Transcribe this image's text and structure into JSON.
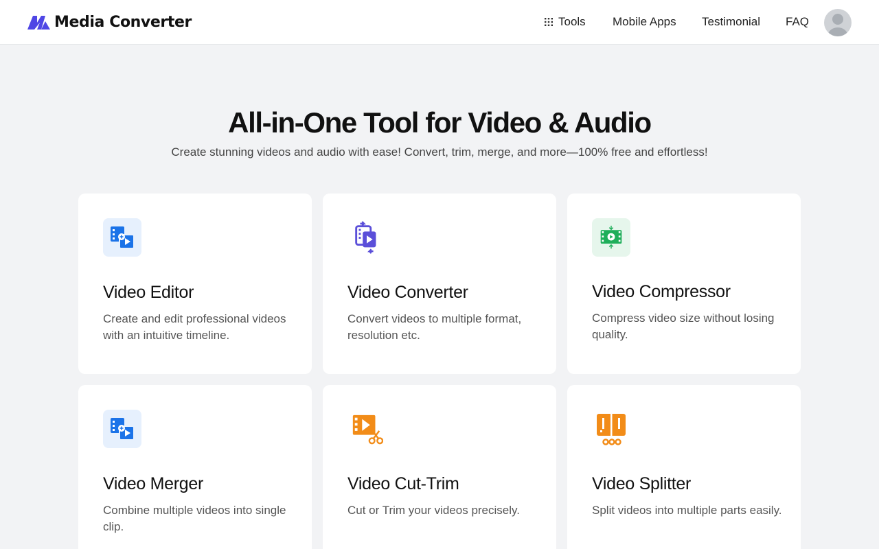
{
  "header": {
    "brand": "Media Converter",
    "nav": [
      {
        "label": "Tools",
        "icon": "grid-icon"
      },
      {
        "label": "Mobile Apps"
      },
      {
        "label": "Testimonial"
      },
      {
        "label": "FAQ"
      }
    ],
    "avatar_icon": "user-avatar-icon"
  },
  "hero": {
    "title": "All-in-One Tool for Video & Audio",
    "subtitle": "Create stunning videos and audio with ease! Convert, trim, merge, and more—100% free and effortless!"
  },
  "tools": [
    {
      "title": "Video Editor",
      "description": "Create and edit professional videos with an intuitive timeline.",
      "icon": "video-editor-icon",
      "color": "#1b73e8"
    },
    {
      "title": "Video Converter",
      "description": "Convert videos to multiple format, resolution etc.",
      "icon": "video-converter-icon",
      "color": "#5b4fd9"
    },
    {
      "title": "Video Compressor",
      "description": "Compress video size without losing quality.",
      "icon": "video-compressor-icon",
      "color": "#1fae5a"
    },
    {
      "title": "Video Merger",
      "description": "Combine multiple videos into single clip.",
      "icon": "video-merger-icon",
      "color": "#1b73e8"
    },
    {
      "title": "Video Cut-Trim",
      "description": "Cut or Trim your videos precisely.",
      "icon": "video-cut-trim-icon",
      "color": "#f28c18"
    },
    {
      "title": "Video Splitter",
      "description": "Split videos into multiple parts easily.",
      "icon": "video-splitter-icon",
      "color": "#f28c18"
    }
  ],
  "colors": {
    "brand": "#4f46e5",
    "background": "#f2f3f5"
  }
}
